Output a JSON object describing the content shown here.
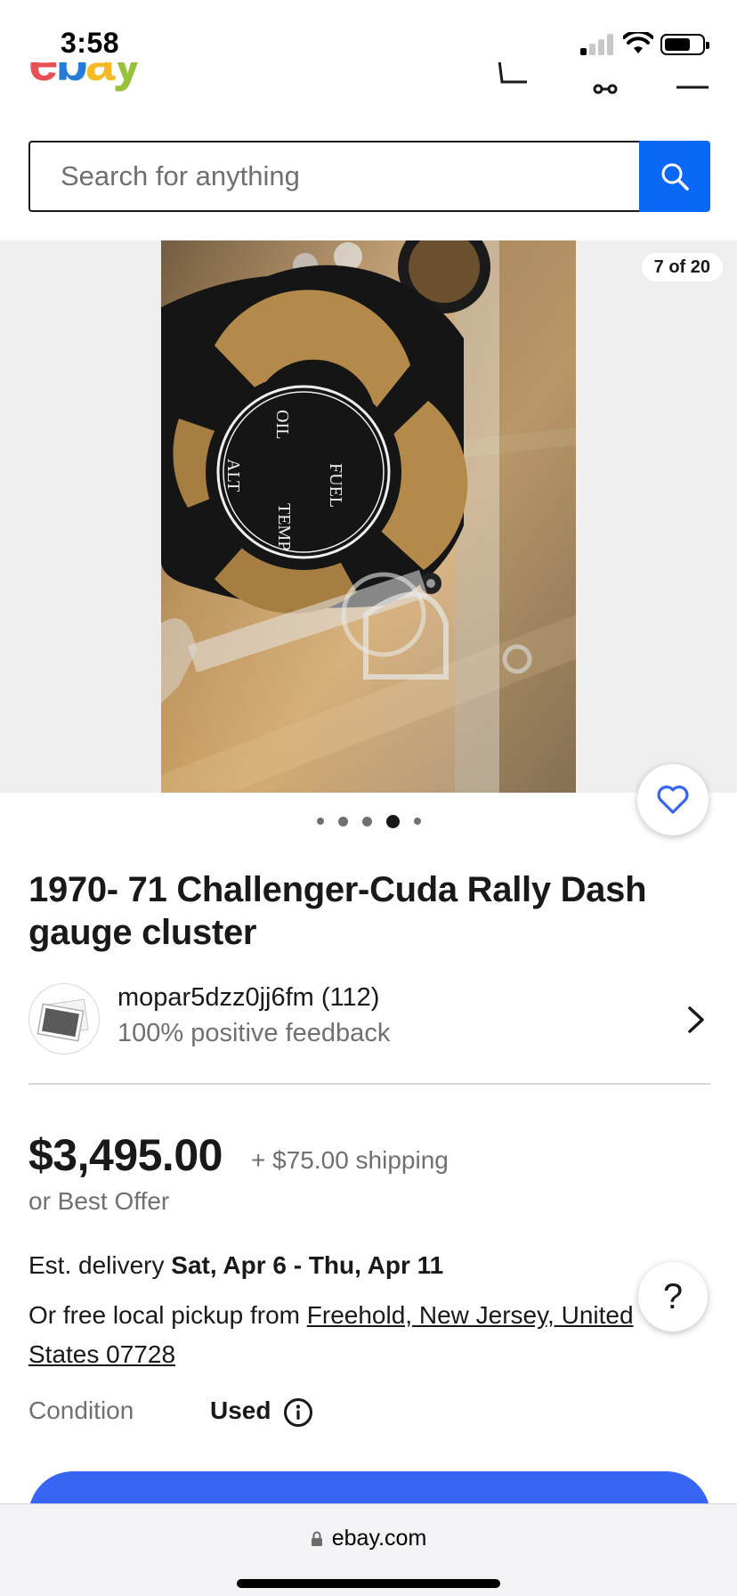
{
  "status_bar": {
    "time": "3:58"
  },
  "header": {
    "logo_letters": [
      "e",
      "b",
      "a",
      "y"
    ]
  },
  "search": {
    "placeholder": "Search for anything"
  },
  "gallery": {
    "counter": "7 of 20",
    "dot_count": 5,
    "active_dot": 4
  },
  "item": {
    "title": "1970- 71 Challenger-Cuda Rally Dash gauge cluster"
  },
  "seller": {
    "name": "mopar5dzz0jj6fm (112)",
    "feedback": "100% positive feedback"
  },
  "pricing": {
    "price": "$3,495.00",
    "shipping": "+ $75.00 shipping",
    "best_offer": "or Best Offer"
  },
  "delivery": {
    "label": "Est. delivery ",
    "dates": "Sat, Apr 6 - Thu, Apr 11",
    "pickup_prefix": "Or free local pickup from ",
    "pickup_location": "Freehold, New Jersey, United States 07728"
  },
  "condition": {
    "label": "Condition",
    "value": "Used"
  },
  "help": {
    "label": "?"
  },
  "browser": {
    "url": "ebay.com"
  },
  "colors": {
    "accent": "#3665f3",
    "search_button": "#0968f6",
    "watch_heart": "#3665f3"
  }
}
